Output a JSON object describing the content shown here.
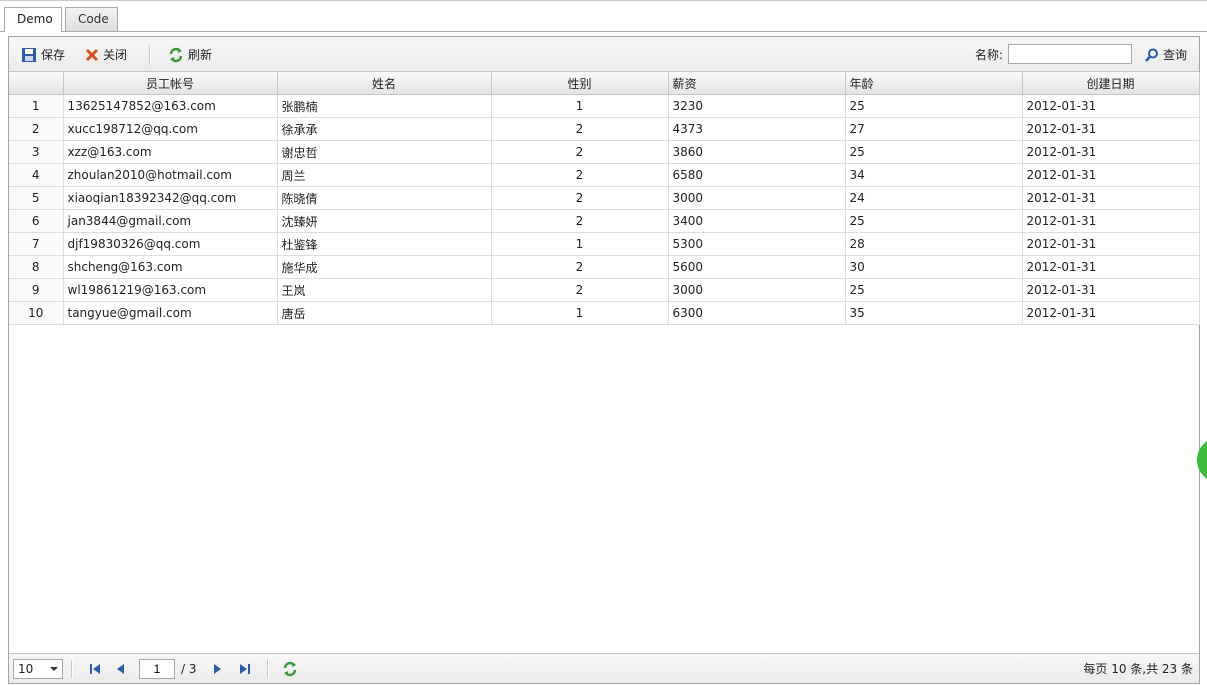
{
  "tabs": [
    {
      "label": "Demo"
    },
    {
      "label": "Code"
    }
  ],
  "toolbar": {
    "save": "保存",
    "close": "关闭",
    "refresh": "刷新",
    "search_label": "名称:",
    "search_value": "",
    "query": "查询"
  },
  "columns": [
    "",
    "员工帐号",
    "姓名",
    "性别",
    "薪资",
    "年龄",
    "创建日期"
  ],
  "rows": [
    [
      "1",
      "13625147852@163.com",
      "张鹏楠",
      "1",
      "3230",
      "25",
      "2012-01-31"
    ],
    [
      "2",
      "xucc198712@qq.com",
      "徐承承",
      "2",
      "4373",
      "27",
      "2012-01-31"
    ],
    [
      "3",
      "xzz@163.com",
      "谢忠哲",
      "2",
      "3860",
      "25",
      "2012-01-31"
    ],
    [
      "4",
      "zhoulan2010@hotmail.com",
      "周兰",
      "2",
      "6580",
      "34",
      "2012-01-31"
    ],
    [
      "5",
      "xiaoqian18392342@qq.com",
      "陈晓倩",
      "2",
      "3000",
      "24",
      "2012-01-31"
    ],
    [
      "6",
      "jan3844@gmail.com",
      "沈臻妍",
      "2",
      "3400",
      "25",
      "2012-01-31"
    ],
    [
      "7",
      "djf19830326@qq.com",
      "杜鉴锋",
      "1",
      "5300",
      "28",
      "2012-01-31"
    ],
    [
      "8",
      "shcheng@163.com",
      "施华成",
      "2",
      "5600",
      "30",
      "2012-01-31"
    ],
    [
      "9",
      "wl19861219@163.com",
      "王岚",
      "2",
      "3000",
      "25",
      "2012-01-31"
    ],
    [
      "10",
      "tangyue@gmail.com",
      "唐岳",
      "1",
      "6300",
      "35",
      "2012-01-31"
    ]
  ],
  "pager": {
    "page_size": "10",
    "current_page": "1",
    "total_pages": "/ 3",
    "info": "每页 10 条,共 23 条"
  },
  "colors": {
    "accent": "#3dbb3d",
    "border": "#a3a3a3"
  }
}
